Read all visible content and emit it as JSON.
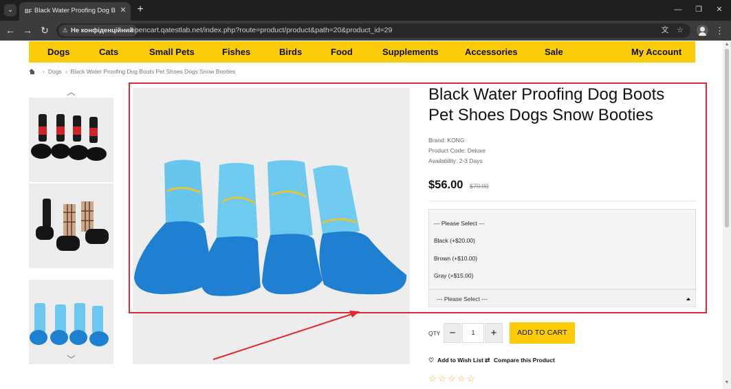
{
  "browser": {
    "tab_title": "Black Water Proofing Dog Boot",
    "tab_favicon": "BF",
    "tab_close_glyph": "✕",
    "new_tab_glyph": "+",
    "secure_label": "Не конфіденційний",
    "url": "opencart.qatestlab.net/index.php?route=product/product&path=20&product_id=29"
  },
  "nav": {
    "categories": [
      "Dogs",
      "Cats",
      "Small Pets",
      "Fishes",
      "Birds",
      "Food",
      "Supplements",
      "Accessories",
      "Sale"
    ],
    "account": "My Account"
  },
  "breadcrumb": {
    "items": [
      "Dogs",
      "Black Water Proofing Dog Boots Pet Shoes Dogs Snow Booties"
    ]
  },
  "product": {
    "title": "Black Water Proofing Dog Boots Pet Shoes Dogs Snow Booties",
    "brand": "Brand: KONG",
    "code": "Product Code: Deluxe",
    "availability": "Availability: 2-3 Days",
    "price": "$56.00",
    "old_price": "$70.00",
    "options": [
      "--- Please Select ---",
      "Black (+$20.00)",
      "Brown (+$10.00)",
      "Gray (+$15.00)"
    ],
    "select_value": "--- Please Select ---",
    "qty_label": "QTY",
    "qty_value": "1",
    "qty_minus": "−",
    "qty_plus": "+",
    "add_to_cart": "ADD TO CART",
    "wishlist": "Add to Wish List",
    "compare": "Compare this Product",
    "rating": 0
  },
  "colors": {
    "accent_yellow": "#f9cb0b",
    "annotation_red": "#e0262f",
    "boot_light_blue": "#5fc3ec",
    "boot_dark_blue": "#1f7fd0"
  }
}
